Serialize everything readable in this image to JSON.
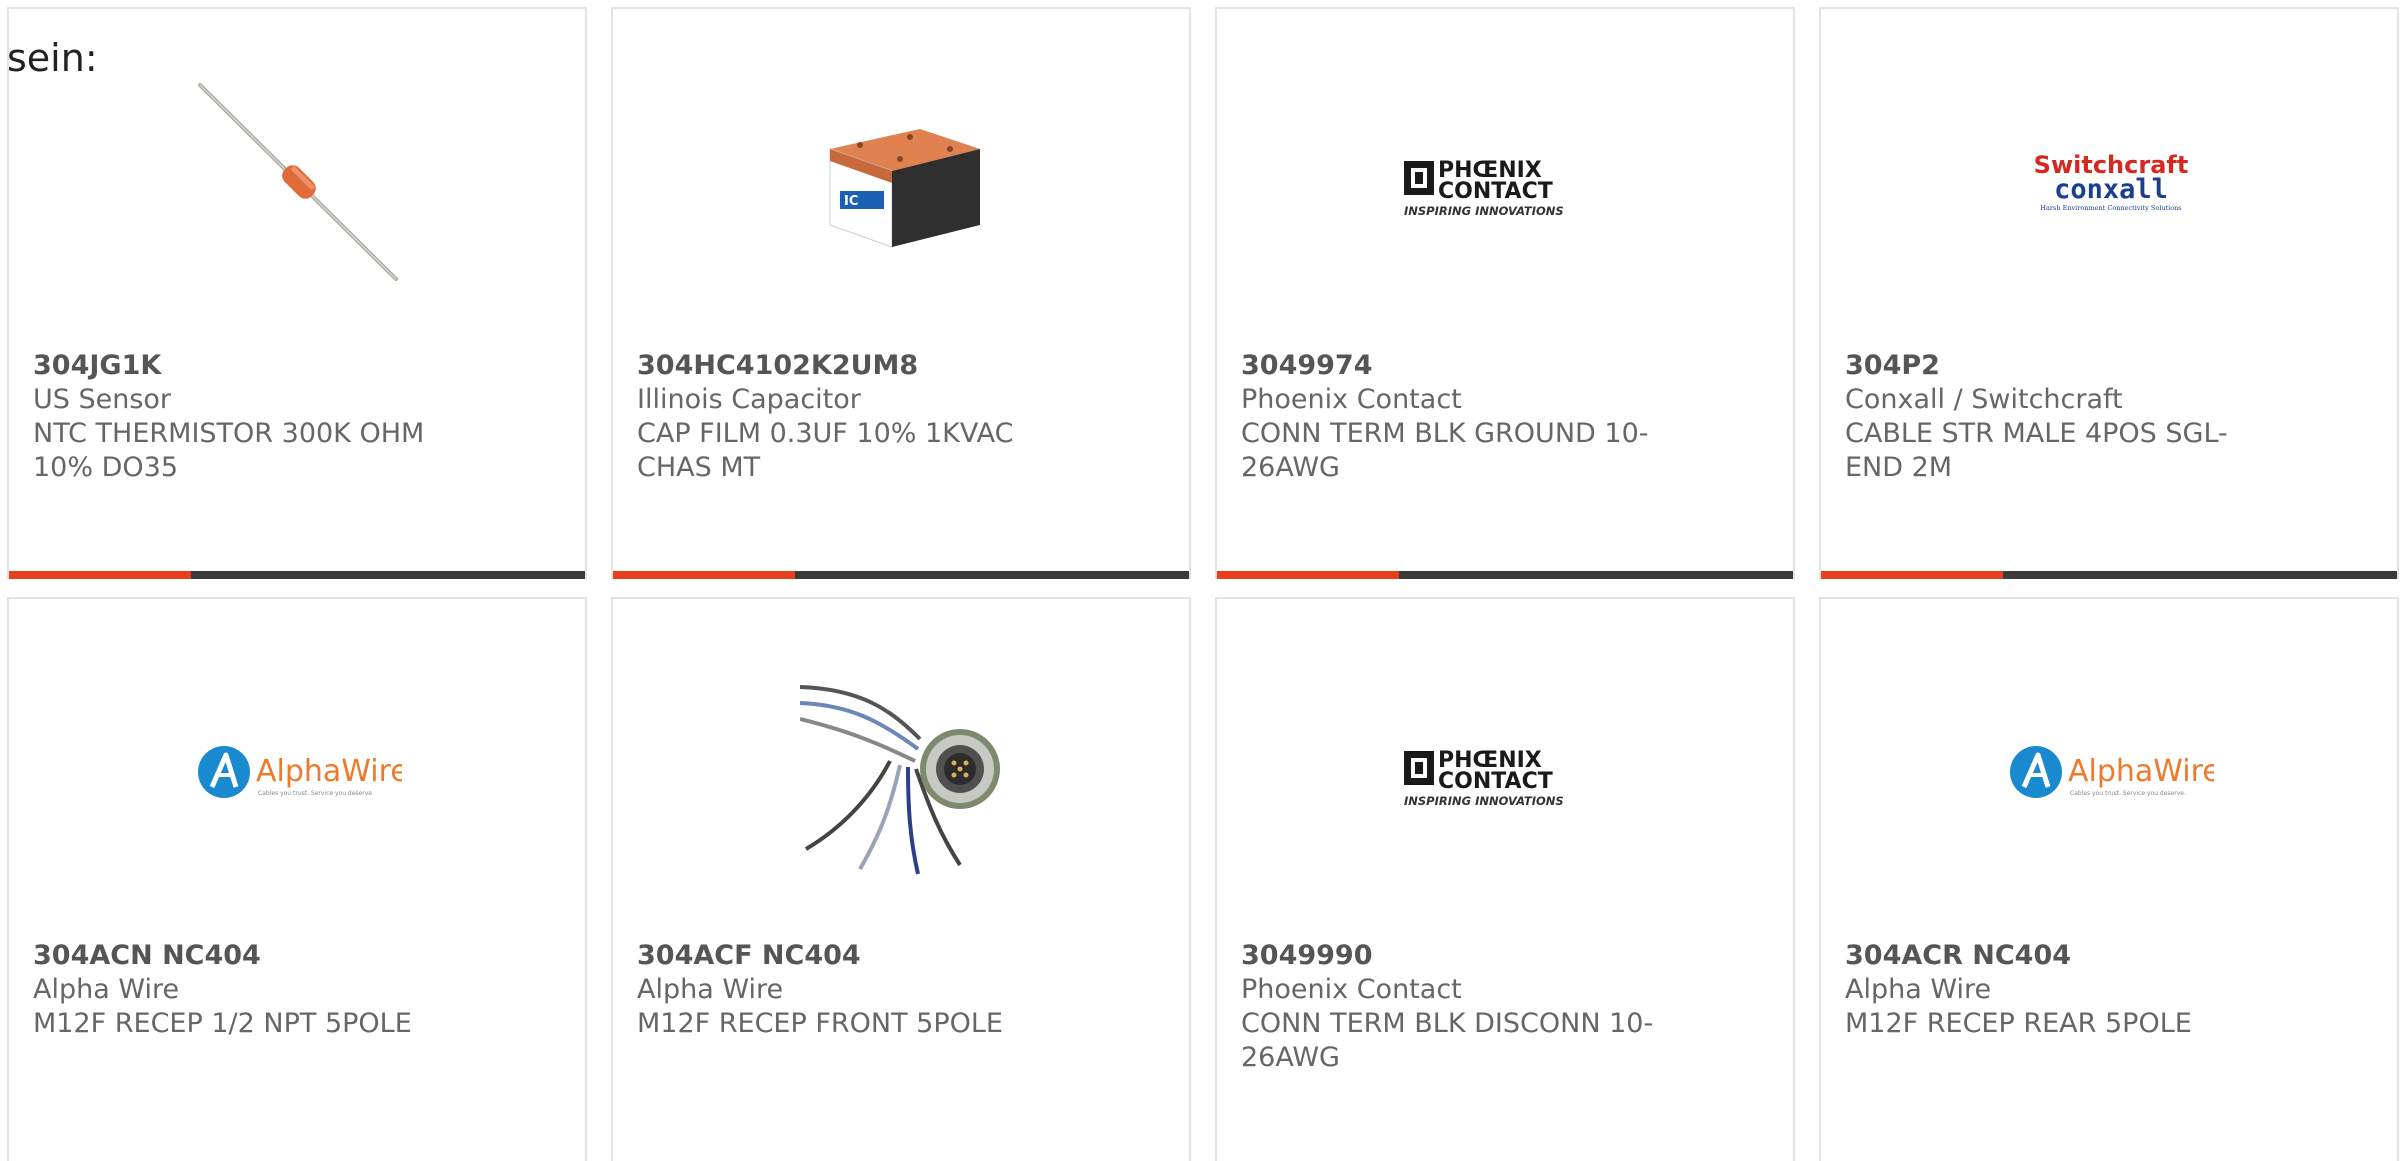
{
  "intro_text": "sein:",
  "colors": {
    "accent": "#e8401c",
    "bar": "#3a3a3a",
    "text": "#666666",
    "border": "#e3e3e3"
  },
  "products": [
    {
      "part_number": "304JG1K",
      "manufacturer": "US Sensor",
      "description": "NTC THERMISTOR 300K OHM 10% DO35",
      "image": "thermistor-icon"
    },
    {
      "part_number": "304HC4102K2UM8",
      "manufacturer": "Illinois Capacitor",
      "description": "CAP FILM 0.3UF 10% 1KVAC CHAS MT",
      "image": "film-capacitor-icon"
    },
    {
      "part_number": "3049974",
      "manufacturer": "Phoenix Contact",
      "description": "CONN TERM BLK GROUND 10-26AWG",
      "image": "phoenix-contact-logo",
      "logo": {
        "line1": "PHŒNIX",
        "line2": "CONTACT",
        "tagline": "INSPIRING INNOVATIONS"
      }
    },
    {
      "part_number": "304P2",
      "manufacturer": "Conxall / Switchcraft",
      "description": "CABLE STR MALE 4POS SGL-END 2M",
      "image": "switchcraft-conxall-logo",
      "logo": {
        "line1": "Switchcraft",
        "line2": "conxall",
        "tagline": "Harsh Environment Connectivity Solutions"
      }
    },
    {
      "part_number": "304ACN NC404",
      "manufacturer": "Alpha Wire",
      "description": "M12F RECEP 1/2 NPT 5POLE",
      "image": "alphawire-logo",
      "logo": {
        "line1": "AlphaWire",
        "tagline": "Cables you trust. Service you deserve."
      }
    },
    {
      "part_number": "304ACF NC404",
      "manufacturer": "Alpha Wire",
      "description": "M12F RECEP FRONT 5POLE",
      "image": "m12-connector-icon"
    },
    {
      "part_number": "3049990",
      "manufacturer": "Phoenix Contact",
      "description": "CONN TERM BLK DISCONN 10-26AWG",
      "image": "phoenix-contact-logo",
      "logo": {
        "line1": "PHŒNIX",
        "line2": "CONTACT",
        "tagline": "INSPIRING INNOVATIONS"
      }
    },
    {
      "part_number": "304ACR NC404",
      "manufacturer": "Alpha Wire",
      "description": "M12F RECEP REAR 5POLE",
      "image": "alphawire-logo",
      "logo": {
        "line1": "AlphaWire",
        "tagline": "Cables you trust. Service you deserve."
      }
    }
  ]
}
